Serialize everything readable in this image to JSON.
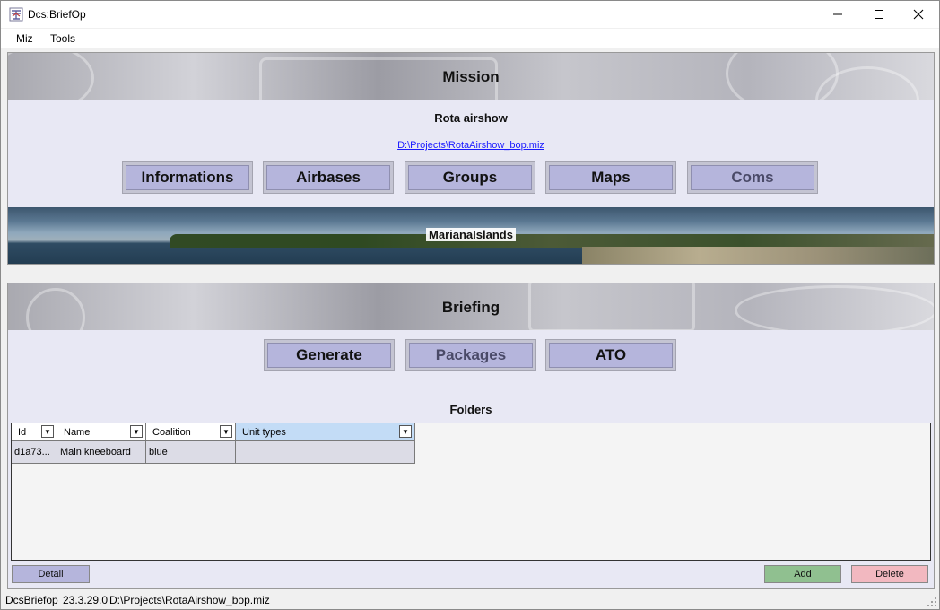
{
  "window": {
    "title": "Dcs:BriefOp"
  },
  "menu": {
    "items": [
      "Miz",
      "Tools"
    ]
  },
  "mission": {
    "header": "Mission",
    "name": "Rota airshow",
    "path": "D:\\Projects\\RotaAirshow_bop.miz",
    "buttons": [
      "Informations",
      "Airbases",
      "Groups",
      "Maps",
      "Coms"
    ],
    "theater": "MarianaIslands"
  },
  "briefing": {
    "header": "Briefing",
    "buttons": [
      "Generate",
      "Packages",
      "ATO"
    ],
    "folders_title": "Folders",
    "columns": [
      "Id",
      "Name",
      "Coalition",
      "Unit types"
    ],
    "rows": [
      {
        "id": "d1a73...",
        "name": "Main kneeboard",
        "coalition": "blue",
        "unit_types": ""
      }
    ],
    "detail_label": "Detail",
    "add_label": "Add",
    "delete_label": "Delete"
  },
  "status": {
    "app": "DcsBriefop",
    "version": "23.3.29.0",
    "path": "D:\\Projects\\RotaAirshow_bop.miz"
  },
  "colors": {
    "button_face": "#b5b5dc",
    "add": "#90c090",
    "delete": "#f2b8c0",
    "link": "#1a1aff"
  }
}
